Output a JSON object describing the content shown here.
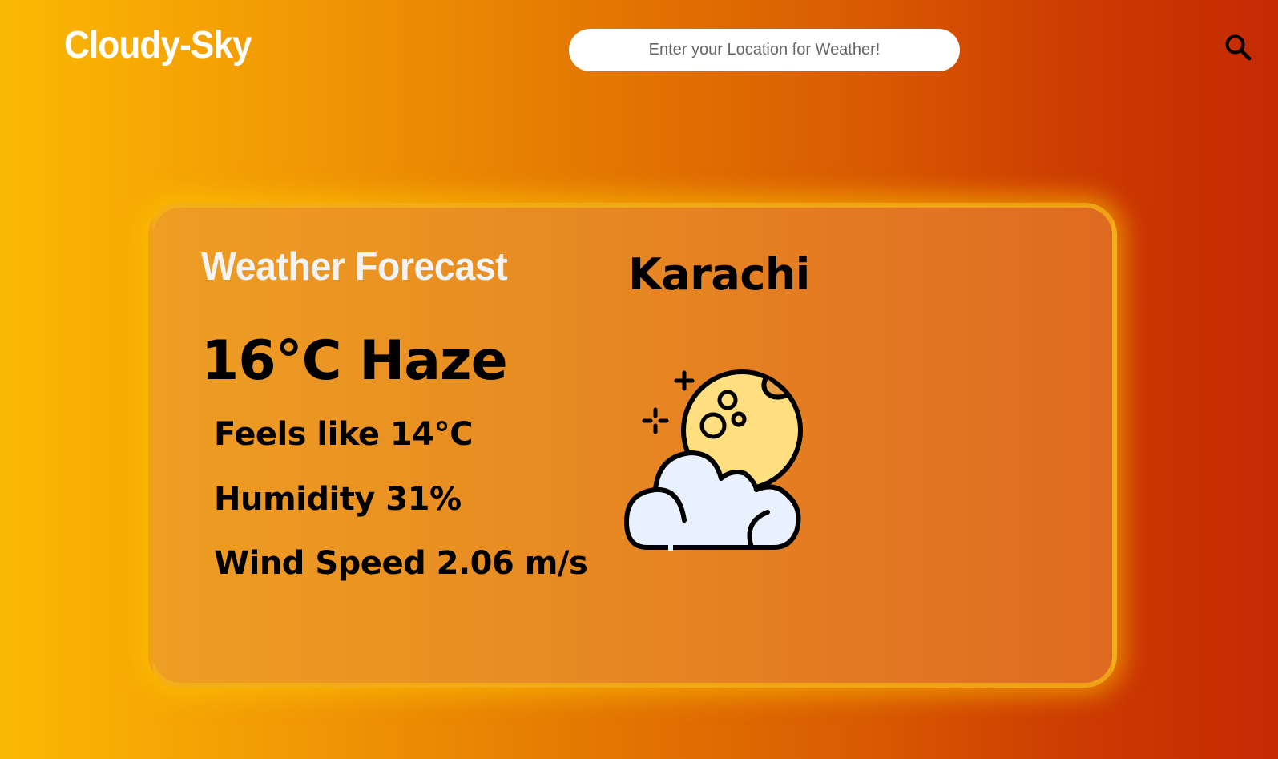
{
  "header": {
    "brand": "Cloudy-Sky",
    "search_placeholder": "Enter your Location for Weather!",
    "search_icon": "search-icon"
  },
  "card": {
    "heading": "Weather Forecast",
    "city": "Karachi",
    "temperature_condition": "16°C Haze",
    "feels_like": "Feels like 14°C",
    "humidity": "Humidity 31%",
    "wind_speed": "Wind Speed 2.06 m/s",
    "weather_icon": "moon-cloud-icon"
  },
  "colors": {
    "gradient_start": "#fbb903",
    "gradient_end": "#c52a03",
    "card_border": "#f5b414",
    "card_glow": "#ffc800",
    "moon": "#ffdf80",
    "cloud": "#e9f1ff"
  }
}
